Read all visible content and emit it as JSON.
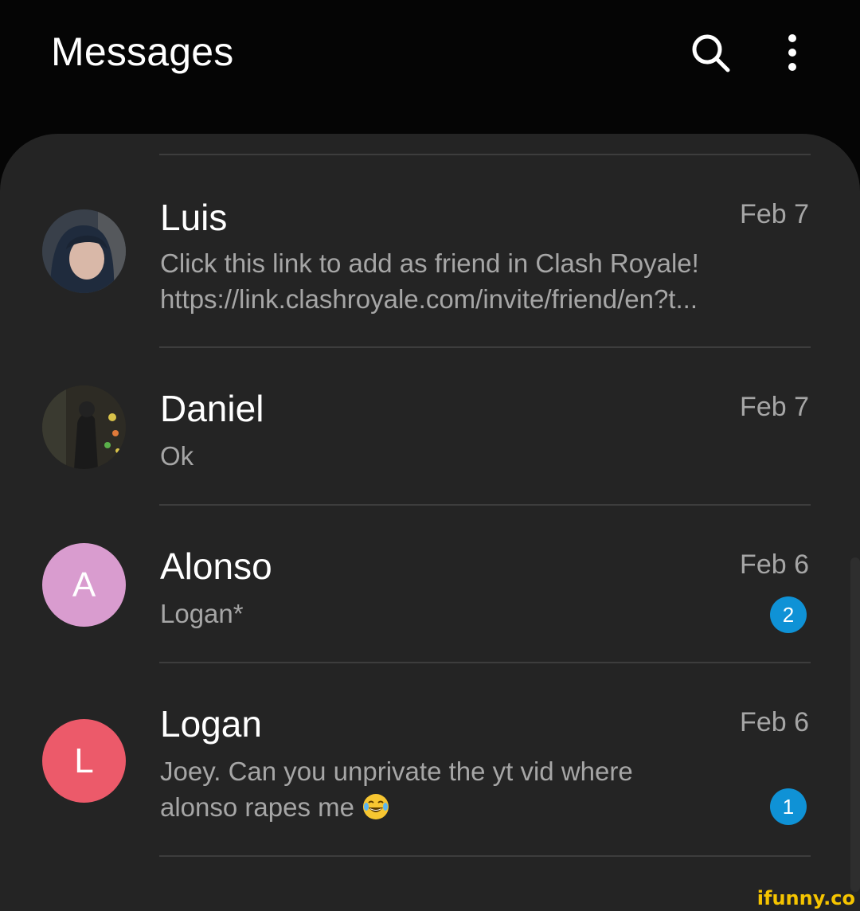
{
  "header": {
    "title": "Messages",
    "search_icon": "search-icon",
    "more_icon": "more-vertical-icon"
  },
  "conversations": [
    {
      "name": "Luis",
      "date": "Feb 7",
      "preview_line1": "Click this link to add as friend in Clash Royale!",
      "preview_line2": "https://link.clashroyale.com/invite/friend/en?t...",
      "avatar": "photo"
    },
    {
      "name": "Daniel",
      "date": "Feb 7",
      "preview_line1": "Ok",
      "avatar": "photo"
    },
    {
      "name": "Alonso",
      "date": "Feb 6",
      "preview_line1": "Logan*",
      "avatar_letter": "A",
      "avatar_color": "#d99ccf",
      "unread": "2"
    },
    {
      "name": "Logan",
      "date": "Feb 6",
      "preview_line1": "Joey. Can you unprivate the yt vid where",
      "preview_line2": "alonso rapes me",
      "avatar_letter": "L",
      "avatar_color": "#ec5a6a",
      "unread": "1"
    }
  ],
  "colors": {
    "background": "#050505",
    "panel": "#242424",
    "divider": "#3d3d3d",
    "secondary_text": "#a6a6a6",
    "badge": "#0f92d6"
  },
  "watermark": "ifunny.co"
}
